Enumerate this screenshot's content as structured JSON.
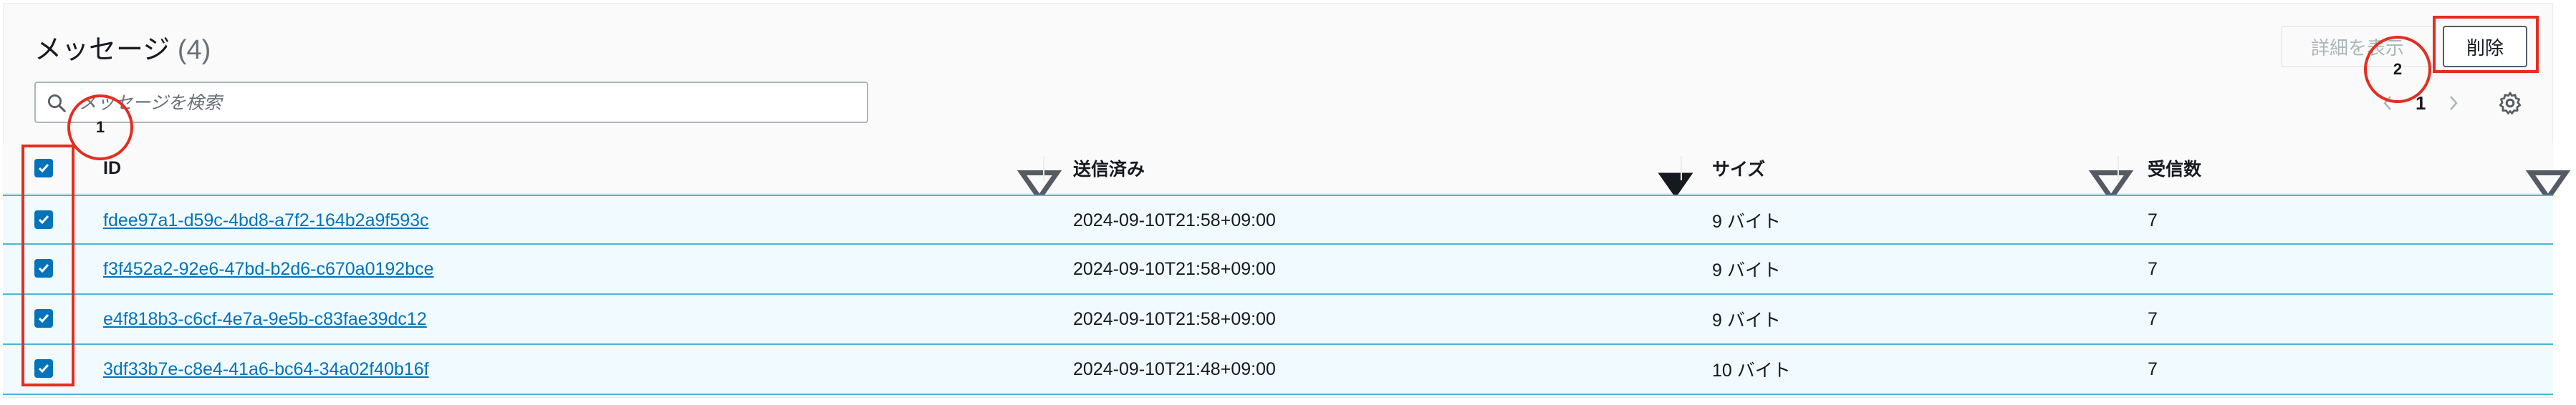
{
  "header": {
    "title": "メッセージ",
    "count": "(4)"
  },
  "toolbar": {
    "details_label": "詳細を表示",
    "delete_label": "削除"
  },
  "search": {
    "placeholder": "メッセージを検索"
  },
  "pagination": {
    "current_page": "1"
  },
  "table": {
    "columns": [
      {
        "label": "ID"
      },
      {
        "label": "送信済み"
      },
      {
        "label": "サイズ"
      },
      {
        "label": "受信数"
      }
    ],
    "rows": [
      {
        "id": "fdee97a1-d59c-4bd8-a7f2-164b2a9f593c",
        "sent": "2024-09-10T21:58+09:00",
        "size": "9 バイト",
        "received": "7"
      },
      {
        "id": "f3f452a2-92e6-47bd-b2d6-c670a0192bce",
        "sent": "2024-09-10T21:58+09:00",
        "size": "9 バイト",
        "received": "7"
      },
      {
        "id": "e4f818b3-c6cf-4e7a-9e5b-c83fae39dc12",
        "sent": "2024-09-10T21:58+09:00",
        "size": "9 バイト",
        "received": "7"
      },
      {
        "id": "3df33b7e-c8e4-41a6-bc64-34a02f40b16f",
        "sent": "2024-09-10T21:48+09:00",
        "size": "10 バイト",
        "received": "7"
      }
    ]
  },
  "annotations": {
    "step1": "1",
    "step2": "2"
  },
  "colors": {
    "accent": "#0073bb",
    "selected_row_bg": "#f1faff",
    "selected_row_border": "#44b9d6",
    "annotation": "#e52d20"
  }
}
